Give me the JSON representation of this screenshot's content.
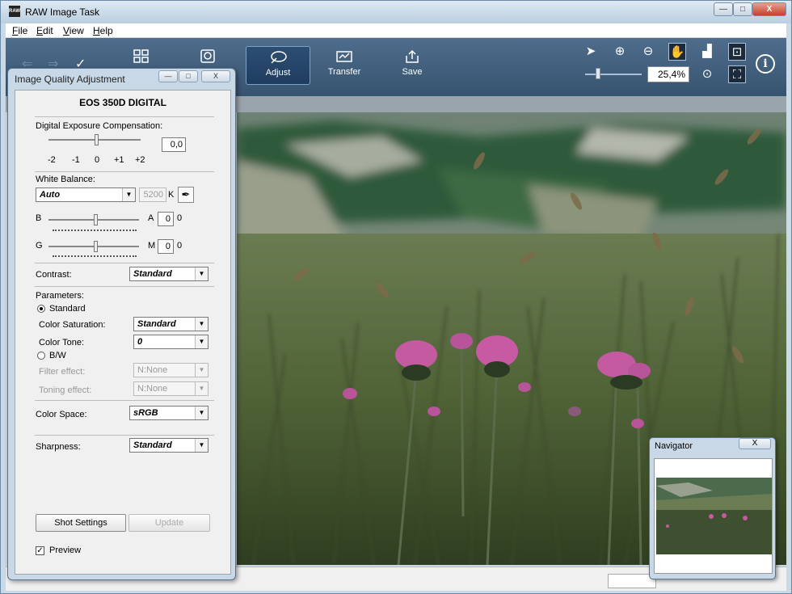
{
  "window": {
    "title": "RAW Image Task",
    "min": "—",
    "max": "□",
    "close": "X"
  },
  "menu": [
    "File",
    "Edit",
    "View",
    "Help"
  ],
  "toolbar": {
    "buttons": [
      {
        "id": "adjust",
        "label": "Adjust"
      },
      {
        "id": "transfer",
        "label": "Transfer"
      },
      {
        "id": "save",
        "label": "Save"
      }
    ],
    "zoom": "25,4%",
    "info": "i"
  },
  "iqa": {
    "title": "Image Quality Adjustment",
    "camera": "EOS 350D DIGITAL",
    "exposure": {
      "label": "Digital Exposure Compensation:",
      "value": "0,0",
      "ticks": [
        "-2",
        "-1",
        "0",
        "+1",
        "+2"
      ]
    },
    "white_balance": {
      "label": "White Balance:",
      "mode": "Auto",
      "kelvin": "5200",
      "unit": "K",
      "b_label": "B",
      "a_label": "A",
      "a_value": "0",
      "a_value2": "0",
      "g_label": "G",
      "m_label": "M",
      "m_value": "0",
      "m_value2": "0"
    },
    "contrast": {
      "label": "Contrast:",
      "value": "Standard"
    },
    "parameters": {
      "label": "Parameters:",
      "standard": "Standard",
      "bw": "B/W",
      "saturation_label": "Color Saturation:",
      "saturation": "Standard",
      "tone_label": "Color Tone:",
      "tone": "0",
      "filter_label": "Filter effect:",
      "filter": "N:None",
      "toning_label": "Toning effect:",
      "toning": "N:None"
    },
    "color_space": {
      "label": "Color Space:",
      "value": "sRGB"
    },
    "sharpness": {
      "label": "Sharpness:",
      "value": "Standard"
    },
    "shot_settings": "Shot Settings",
    "update": "Update",
    "preview": "Preview",
    "preview_checked": "✓"
  },
  "navigator": {
    "title": "Navigator",
    "close": "X"
  }
}
